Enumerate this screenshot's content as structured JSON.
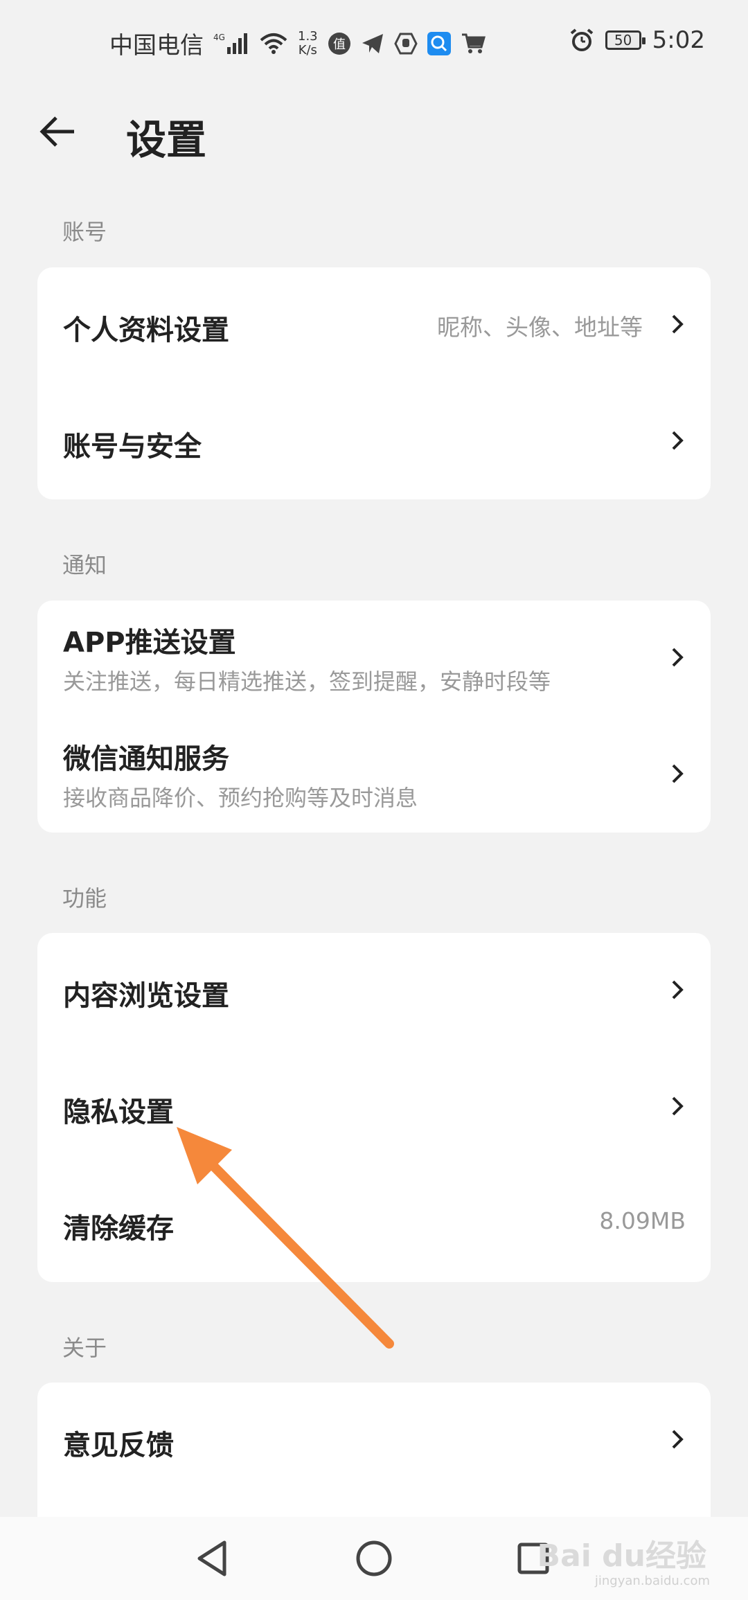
{
  "status_bar": {
    "carrier": "中国电信",
    "network": "4G",
    "speed_value": "1.3",
    "speed_unit": "K/s",
    "app_icons": [
      "zhidemai-icon",
      "telegram-icon",
      "hand-icon",
      "search-app-icon",
      "cart-icon"
    ],
    "battery": "50",
    "time": "5:02"
  },
  "header": {
    "title": "设置"
  },
  "sections": {
    "account": {
      "label": "账号",
      "rows": [
        {
          "title": "个人资料设置",
          "value": "昵称、头像、地址等"
        },
        {
          "title": "账号与安全"
        }
      ]
    },
    "notify": {
      "label": "通知",
      "rows": [
        {
          "title": "APP推送设置",
          "subtitle": "关注推送，每日精选推送，签到提醒，安静时段等"
        },
        {
          "title": "微信通知服务",
          "subtitle": "接收商品降价、预约抢购等及时消息"
        }
      ]
    },
    "features": {
      "label": "功能",
      "rows": [
        {
          "title": "内容浏览设置"
        },
        {
          "title": "隐私设置"
        },
        {
          "title": "清除缓存",
          "value": "8.09MB"
        }
      ]
    },
    "about": {
      "label": "关于",
      "rows": [
        {
          "title": "意见反馈"
        }
      ]
    }
  },
  "annotation": {
    "arrow_color": "#f5883b"
  },
  "watermark": {
    "text": "Bai du经验",
    "sub": "jingyan.baidu.com"
  },
  "colors": {
    "background": "#f2f2f2",
    "card": "#ffffff",
    "secondary_text": "#999999",
    "accent_arrow": "#f5883b"
  }
}
